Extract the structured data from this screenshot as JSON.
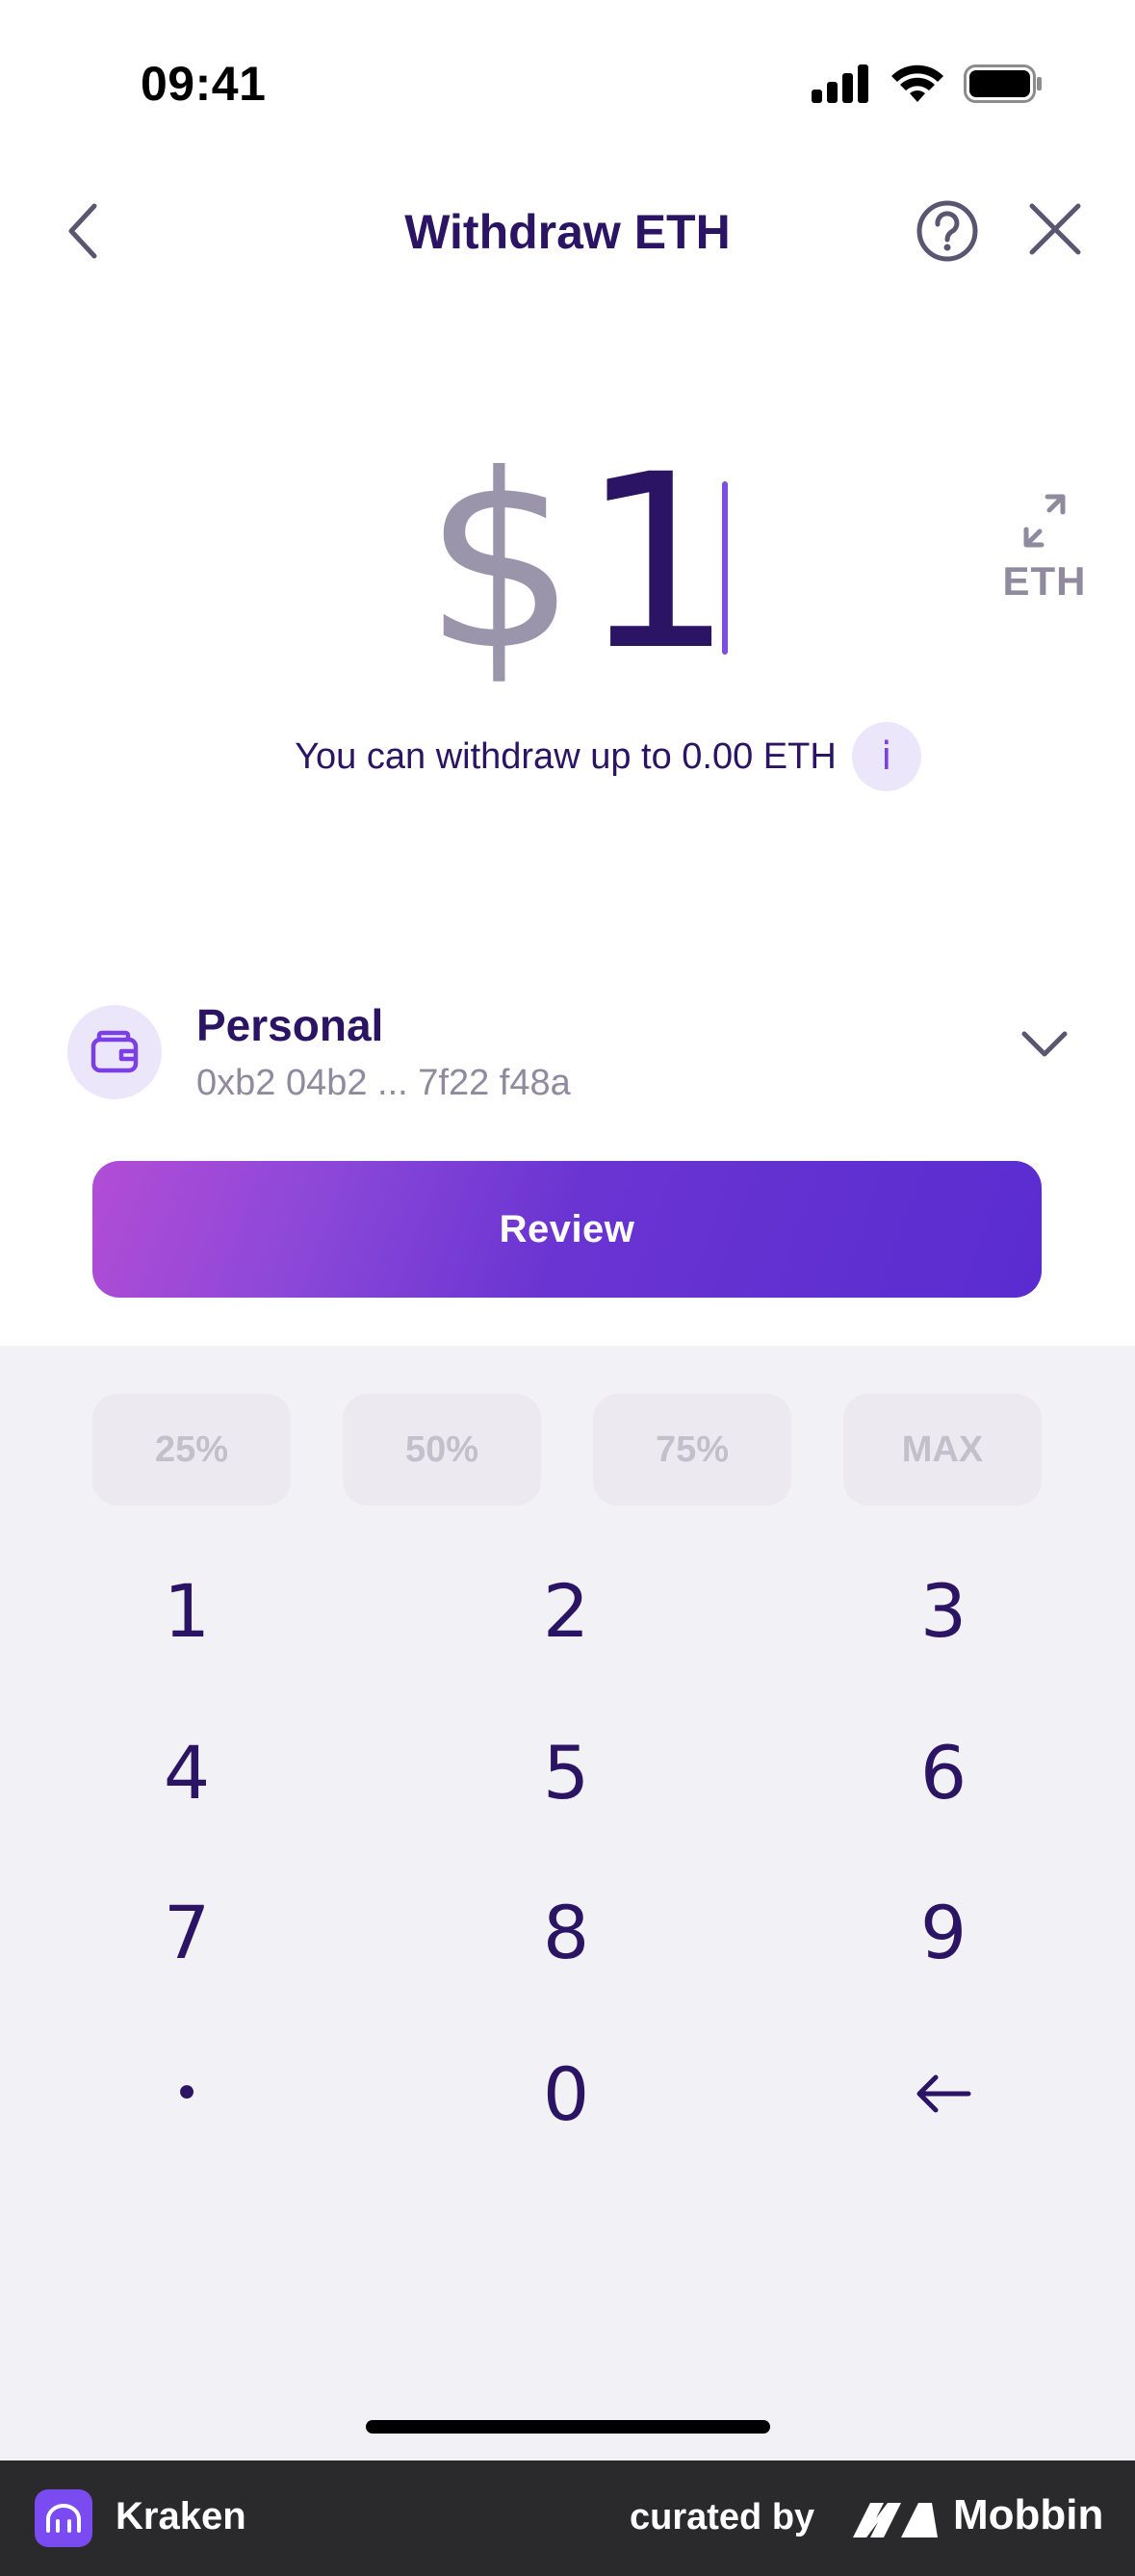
{
  "status_bar": {
    "time": "09:41"
  },
  "header": {
    "title": "Withdraw ETH"
  },
  "amount": {
    "currency_symbol": "$",
    "value": "1",
    "toggle_label": "ETH"
  },
  "limit": {
    "text": "You can withdraw up to 0.00 ETH",
    "info_symbol": "i"
  },
  "wallet": {
    "name": "Personal",
    "address": "0xb2 04b2 ... 7f22 f48a"
  },
  "review_button": {
    "label": "Review"
  },
  "percent_buttons": [
    "25%",
    "50%",
    "75%",
    "MAX"
  ],
  "keypad": {
    "k1": "1",
    "k2": "2",
    "k3": "3",
    "k4": "4",
    "k5": "5",
    "k6": "6",
    "k7": "7",
    "k8": "8",
    "k9": "9",
    "kdot": "•",
    "k0": "0"
  },
  "footer": {
    "app_name": "Kraken",
    "curated_by": "curated by",
    "curator": "Mobbin"
  },
  "colors": {
    "primary_text": "#2a1463",
    "accent": "#7b3fe4",
    "keypad_bg": "#f2f1f5"
  }
}
